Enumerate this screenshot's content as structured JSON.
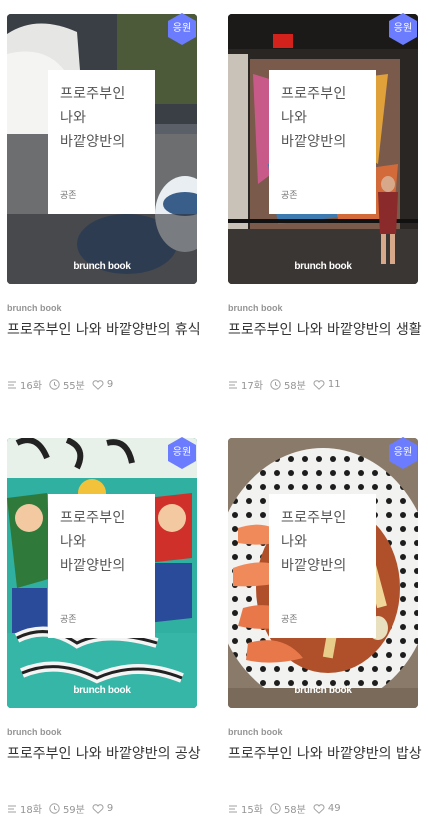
{
  "cards": [
    {
      "badge": "응원",
      "cover_title": "프로주부인\n나와\n바깥양반의",
      "cover_author": "공존",
      "wordmark": "brunch book",
      "brand": "brunch book",
      "title": "프로주부인 나와 바깥양반의 휴식",
      "episodes": "16화",
      "read_time": "55분",
      "likes": "9"
    },
    {
      "badge": "응원",
      "cover_title": "프로주부인\n나와\n바깥양반의",
      "cover_author": "공존",
      "wordmark": "brunch book",
      "brand": "brunch book",
      "title": "프로주부인 나와 바깥양반의 생활",
      "episodes": "17화",
      "read_time": "58분",
      "likes": "11"
    },
    {
      "badge": "응원",
      "cover_title": "프로주부인\n나와\n바깥양반의",
      "cover_author": "공존",
      "wordmark": "brunch book",
      "brand": "brunch book",
      "title": "프로주부인 나와 바깥양반의 공상",
      "episodes": "18화",
      "read_time": "59분",
      "likes": "9"
    },
    {
      "badge": "응원",
      "cover_title": "프로주부인\n나와\n바깥양반의",
      "cover_author": "공존",
      "wordmark": "brunch book",
      "brand": "brunch book",
      "title": "프로주부인 나와 바깥양반의 밥상",
      "episodes": "15화",
      "read_time": "58분",
      "likes": "49"
    }
  ],
  "icons": {
    "episodes": "list-icon",
    "read_time": "clock-icon",
    "likes": "heart-icon"
  },
  "colors": {
    "badge": "#6b7cff",
    "meta_text": "#959595",
    "title_text": "#333333"
  }
}
